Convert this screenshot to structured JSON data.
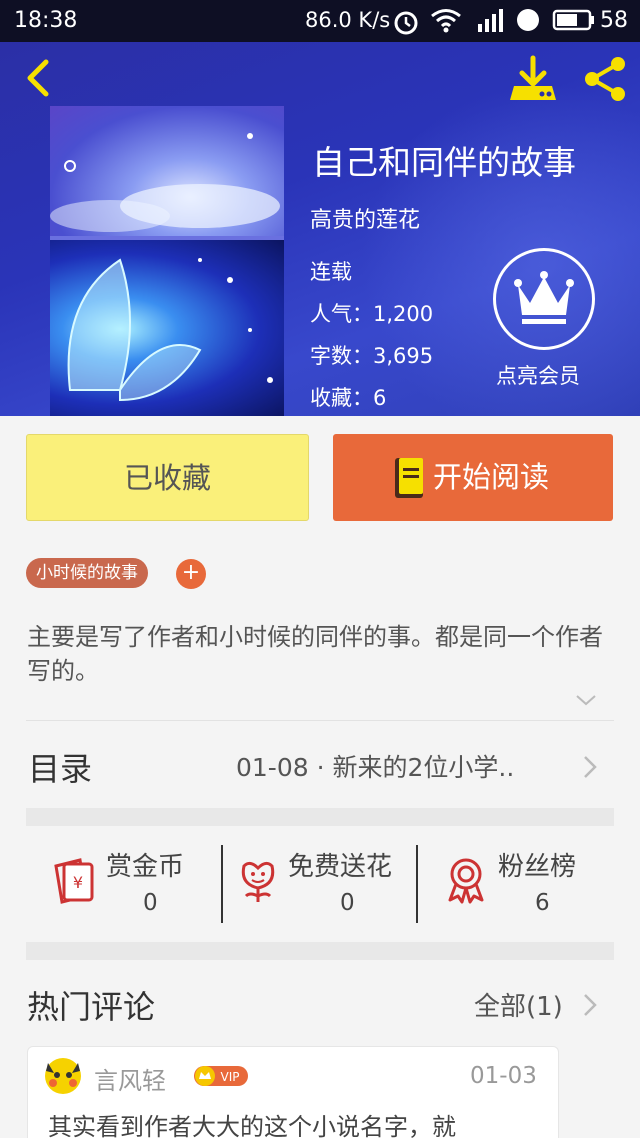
{
  "status_bar": {
    "time": "18:38",
    "net_speed": "86.0 K/s",
    "battery": "58",
    "icons": [
      "alarm-icon",
      "wifi-icon",
      "signal-4g-icon",
      "hd-icon",
      "battery-icon"
    ]
  },
  "header": {
    "icons": {
      "back": "back-arrow-icon",
      "download": "download-icon",
      "share": "share-icon"
    },
    "accent_color": "#f6e000"
  },
  "book": {
    "title": "自己和同伴的故事",
    "author": "高贵的莲花",
    "status": "连载",
    "popularity": "人气：1,200",
    "word_count": "字数：3,695",
    "favorites": "收藏：6"
  },
  "vip": {
    "label": "点亮会员",
    "icon": "crown-icon"
  },
  "actions": {
    "collected_label": "已收藏",
    "read_label": "开始阅读",
    "collected_color": "#faf07a",
    "read_color": "#e8693a"
  },
  "tags": {
    "items": [
      "小时候的故事"
    ],
    "add_label": "+"
  },
  "description": "主要是写了作者和小时候的同伴的事。都是同一个作者写的。",
  "toc": {
    "label": "目录",
    "latest_chapter": "01-08 · 新来的2位小学.."
  },
  "stats": {
    "reward": {
      "label": "赏金币",
      "value": "0",
      "icon": "red-envelope-icon"
    },
    "flowers": {
      "label": "免费送花",
      "value": "0",
      "icon": "flower-icon"
    },
    "fans": {
      "label": "粉丝榜",
      "value": "6",
      "icon": "award-ribbon-icon"
    }
  },
  "comments": {
    "title": "热门评论",
    "all_label": "全部(1)",
    "items": [
      {
        "user": "言风轻",
        "badge": "VIP",
        "date": "01-03",
        "text": "其实看到作者大大的这个小说名字，就"
      }
    ]
  }
}
